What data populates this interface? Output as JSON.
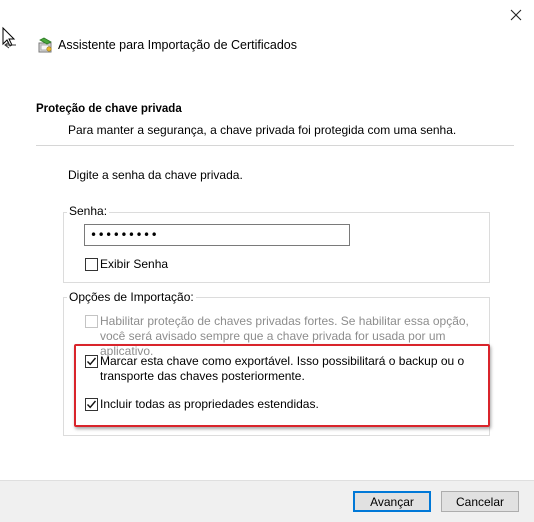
{
  "window": {
    "title": "Assistente para Importação de Certificados",
    "close_icon": "close-icon",
    "back_icon": "back-arrow-icon",
    "app_icon": "certificate-wizard-icon"
  },
  "header": {
    "section_title": "Proteção de chave privada",
    "section_description": "Para manter a segurança, a chave privada foi protegida com uma senha."
  },
  "body": {
    "prompt": "Digite a senha da chave privada."
  },
  "password_group": {
    "label": "Senha:",
    "value": "•••••••••",
    "show_password": {
      "label": "Exibir Senha",
      "checked": false
    }
  },
  "import_options": {
    "label": "Opções de Importação:",
    "options": [
      {
        "label": "Habilitar proteção de chaves privadas fortes. Se habilitar essa opção, você será avisado sempre que a chave privada for usada por um aplicativo.",
        "checked": false,
        "enabled": false
      },
      {
        "label": "Marcar esta chave como exportável. Isso possibilitará o backup ou o transporte das chaves posteriormente.",
        "checked": true,
        "enabled": true
      },
      {
        "label": "Incluir todas as propriedades estendidas.",
        "checked": true,
        "enabled": true
      }
    ],
    "highlight_color": "#d9242b"
  },
  "footer": {
    "next_label": "Avançar",
    "cancel_label": "Cancelar"
  },
  "colors": {
    "accent": "#0078d7",
    "footer_bg": "#f0f0f0"
  }
}
